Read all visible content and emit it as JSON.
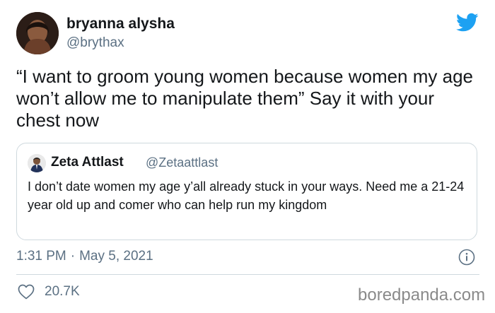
{
  "author": {
    "name": "bryanna alysha",
    "handle": "@brythax"
  },
  "tweet": {
    "text": "“I want to groom young women because women my age won’t allow me to manipulate them” Say it with your chest now"
  },
  "quoted_tweet": {
    "author_name": "Zeta Attlast",
    "author_handle": "@Zetaattlast",
    "text": "I don’t date women my age y’all already stuck in your ways. Need me a 21-24 year old up and comer who can help run my kingdom"
  },
  "meta": {
    "time": "1:31 PM",
    "separator": "·",
    "date": "May 5, 2021"
  },
  "engagement": {
    "likes": "20.7K"
  },
  "watermark": "boredpanda.com",
  "icons": [
    "twitter-bird-icon",
    "info-icon",
    "heart-icon"
  ],
  "colors": {
    "twitter_blue": "#1da1f2",
    "secondary_text": "#5b7083",
    "border": "#cfd9de",
    "watermark": "#8a8a8a"
  }
}
